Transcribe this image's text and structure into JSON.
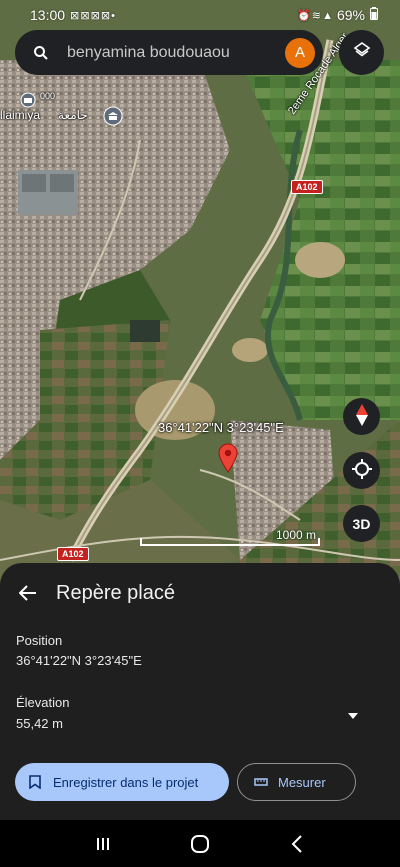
{
  "status_bar": {
    "time": "13:00",
    "left_icons": "⊠ ⊠ ⊠ ⊠ •",
    "right_icons": "⏰ ≋ ▲",
    "battery": "69%"
  },
  "search": {
    "query": "benyamina boudouaou",
    "avatar_letter": "A"
  },
  "map": {
    "labels": {
      "town": "llaimiya",
      "arabic": "جامعة",
      "arabic_small": "000",
      "road_name": "2eme Rocade Alger",
      "road_shield_top": "A102",
      "road_shield_bottom": "A102"
    },
    "marker_coordinates": "36°41'22\"N 3°23'45\"E",
    "scale_label": "1000 m",
    "three_d_label": "3D"
  },
  "panel": {
    "title": "Repère placé",
    "position_label": "Position",
    "position_value": "36°41'22\"N 3°23'45\"E",
    "elevation_label": "Élevation",
    "elevation_value": "55,42 m",
    "save_button_label": "Enregistrer dans le projet",
    "measure_button_label": "Mesurer"
  },
  "colors": {
    "accent": "#a8c7fa",
    "avatar": "#e8710a",
    "panel_bg": "#1f1f1f",
    "pin": "#ea4335"
  }
}
